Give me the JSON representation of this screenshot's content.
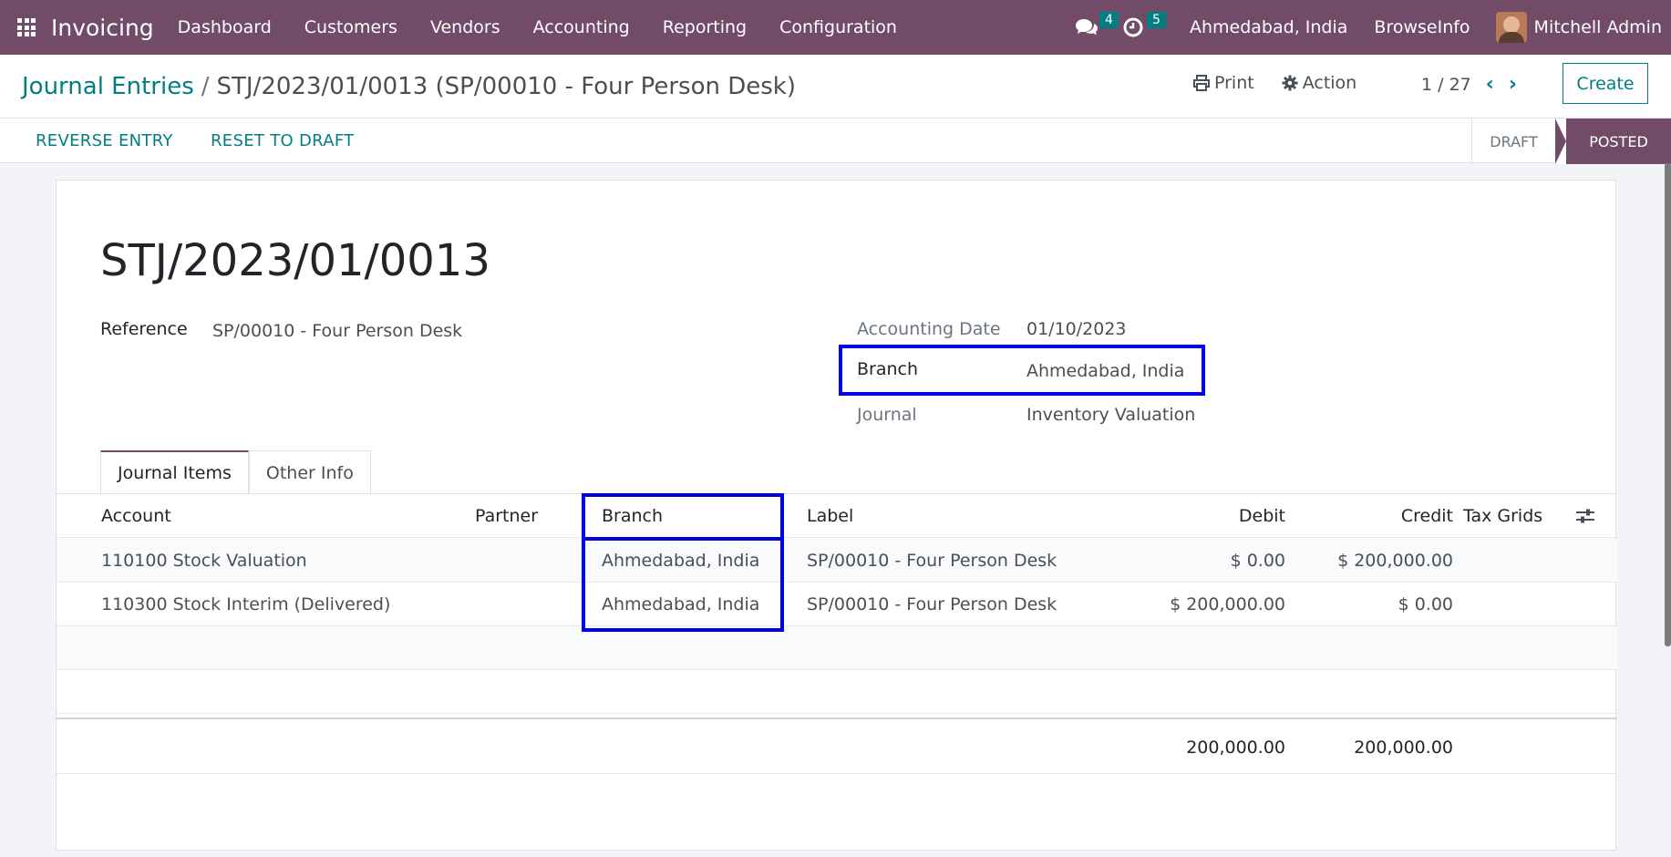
{
  "navbar": {
    "app_name": "Invoicing",
    "menu": [
      "Dashboard",
      "Customers",
      "Vendors",
      "Accounting",
      "Reporting",
      "Configuration"
    ],
    "messages_count": "4",
    "activities_count": "5",
    "branch": "Ahmedabad, India",
    "company": "BrowseInfo",
    "user": "Mitchell Admin",
    "icons": {
      "apps": "apps-grid-icon",
      "messages": "chat-icon",
      "activities": "clock-icon"
    }
  },
  "breadcrumb": {
    "parent": "Journal Entries",
    "separator": "/",
    "current": "STJ/2023/01/0013 (SP/00010 - Four Person Desk)"
  },
  "actions": {
    "print": "Print",
    "action": "Action",
    "pager": "1 / 27",
    "create": "Create"
  },
  "statusbar": {
    "reverse": "REVERSE ENTRY",
    "reset": "RESET TO DRAFT",
    "stages": [
      "DRAFT",
      "POSTED"
    ],
    "current_stage": "POSTED"
  },
  "record": {
    "name": "STJ/2023/01/0013",
    "reference_label": "Reference",
    "reference": "SP/00010 - Four Person Desk",
    "accounting_date_label": "Accounting Date",
    "accounting_date": "01/10/2023",
    "branch_label": "Branch",
    "branch": "Ahmedabad, India",
    "journal_label": "Journal",
    "journal": "Inventory Valuation"
  },
  "tabs": [
    "Journal Items",
    "Other Info"
  ],
  "lines": {
    "columns": [
      "Account",
      "Partner",
      "Branch",
      "Label",
      "Debit",
      "Credit",
      "Tax Grids"
    ],
    "rows": [
      {
        "account": "110100 Stock Valuation",
        "partner": "",
        "branch": "Ahmedabad, India",
        "label": "SP/00010 - Four Person Desk",
        "debit": "$ 0.00",
        "credit": "$ 200,000.00",
        "tax_grids": ""
      },
      {
        "account": "110300 Stock Interim (Delivered)",
        "partner": "",
        "branch": "Ahmedabad, India",
        "label": "SP/00010 - Four Person Desk",
        "debit": "$ 200,000.00",
        "credit": "$ 0.00",
        "tax_grids": ""
      }
    ],
    "total_debit": "200,000.00",
    "total_credit": "200,000.00"
  },
  "colors": {
    "brand": "#714b67",
    "accent": "#017e84",
    "highlight": "#0000e6"
  }
}
